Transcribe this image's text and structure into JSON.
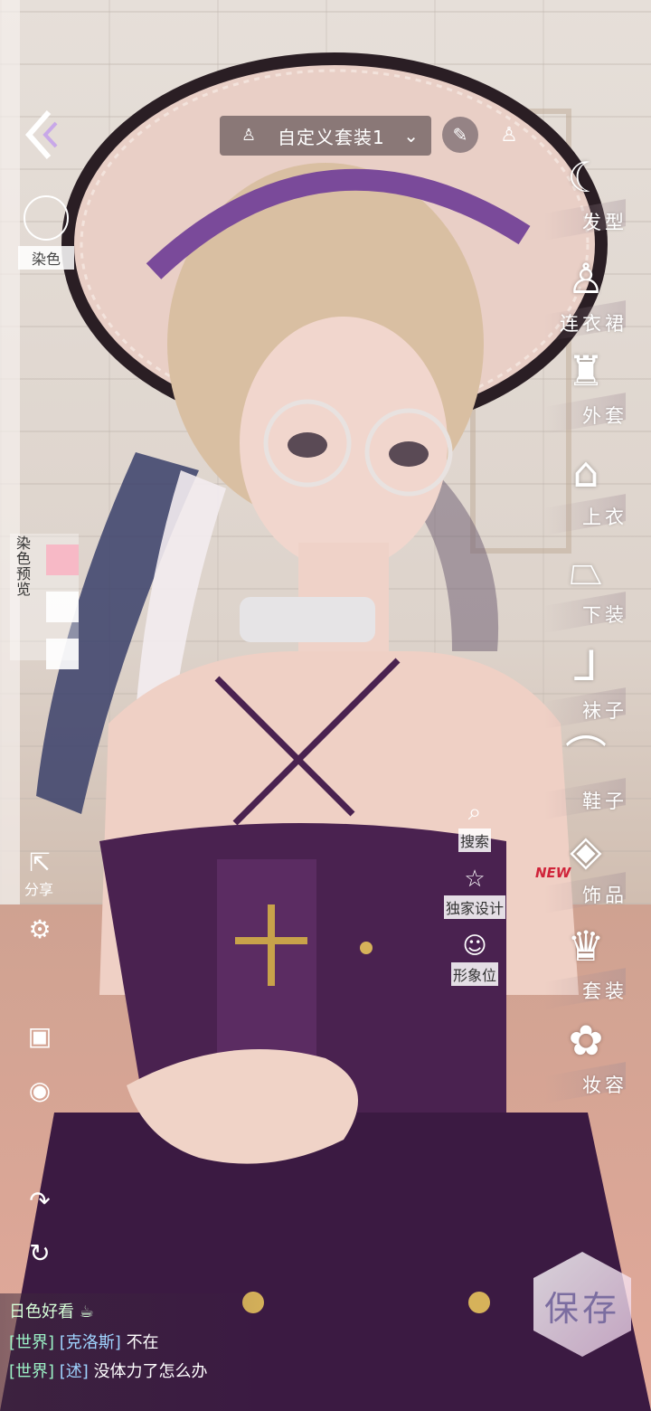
{
  "top_bar": {
    "outfit_name": "自定义套装1"
  },
  "left_panel": {
    "dye_label": "染色",
    "dye_preview_label": "染色预览",
    "share_label": "分享"
  },
  "categories": [
    {
      "label": "发型",
      "icon": "hair-icon"
    },
    {
      "label": "连衣裙",
      "icon": "dress-icon"
    },
    {
      "label": "外套",
      "icon": "coat-icon"
    },
    {
      "label": "上衣",
      "icon": "top-icon"
    },
    {
      "label": "下装",
      "icon": "skirt-icon"
    },
    {
      "label": "袜子",
      "icon": "socks-icon"
    },
    {
      "label": "鞋子",
      "icon": "shoes-icon"
    },
    {
      "label": "饰品",
      "icon": "accessory-icon"
    },
    {
      "label": "套装",
      "icon": "suit-icon"
    },
    {
      "label": "妆容",
      "icon": "makeup-icon"
    }
  ],
  "new_badge": "NEW",
  "mid_actions": {
    "search_label": "搜索",
    "exclusive_label": "独家设计",
    "image_slot_label": "形象位"
  },
  "chat": [
    {
      "text": "日色好看"
    },
    {
      "channel": "[世界]",
      "name": "[克洛斯]",
      "message": "不在"
    },
    {
      "channel": "[世界]",
      "name": "[述]",
      "message": "没体力了怎么办"
    }
  ],
  "save_label": "保存",
  "colors": {
    "dress_purple": "#4a2250",
    "hat_pink": "#e9cfc6",
    "accent_pink": "#f7b9c6",
    "new_red": "#d0243a"
  }
}
